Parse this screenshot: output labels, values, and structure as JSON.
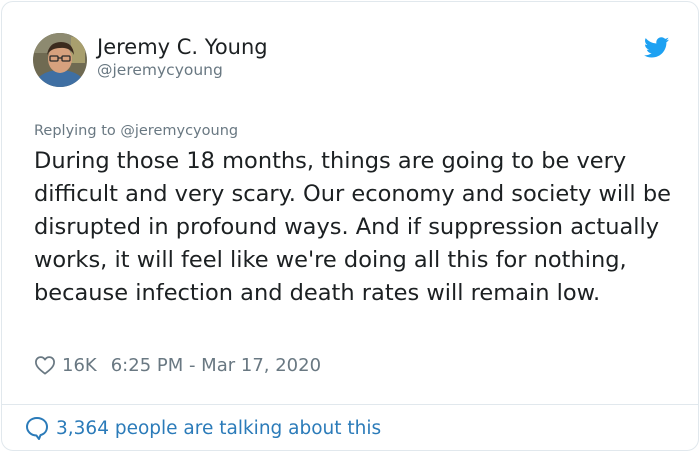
{
  "author": {
    "display_name": "Jeremy C. Young",
    "handle": "@jeremycyoung"
  },
  "reply_context": "Replying to @jeremycyoung",
  "tweet": {
    "text": "During those 18 months, things are going to be very difficult and very scary. Our economy and society will be disrupted in profound ways. And if suppression actually works, it will feel like we're doing all this for nothing, because infection and death rates will remain low."
  },
  "meta": {
    "likes": "16K",
    "timestamp": "6:25 PM - Mar 17, 2020"
  },
  "footer": {
    "talking_label": "3,364 people are talking about this"
  },
  "icons": {
    "brand": "twitter-bird-icon",
    "like": "heart-icon",
    "conversation": "speech-bubble-icon"
  },
  "colors": {
    "twitter_blue": "#1da1f2",
    "link_blue": "#2b7bb9",
    "secondary_text": "#697882",
    "primary_text": "#1c2022",
    "border": "#e1e8ed"
  }
}
